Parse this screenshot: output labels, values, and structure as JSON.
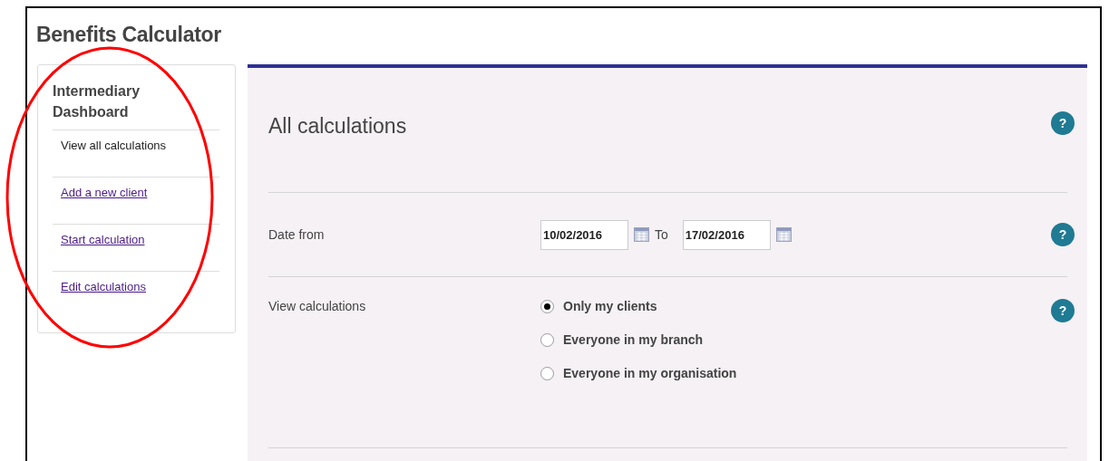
{
  "window": {
    "title": "Benefits Calculator"
  },
  "sidebar": {
    "heading": "Intermediary Dashboard",
    "items": [
      {
        "label": "View all calculations",
        "selected": true
      },
      {
        "label": "Add a new client",
        "selected": false
      },
      {
        "label": "Start calculation",
        "selected": false
      },
      {
        "label": "Edit calculations",
        "selected": false
      }
    ]
  },
  "panel": {
    "heading": "All calculations",
    "help": "?",
    "rows": [
      {
        "kind": "date_range",
        "label": "Date from",
        "date_from": "10/02/2016",
        "separator": "To",
        "date_to": "17/02/2016",
        "help": "?"
      },
      {
        "kind": "radio_group",
        "label": "View calculations",
        "help": "?",
        "options": [
          {
            "label": "Only my clients",
            "selected": true
          },
          {
            "label": "Everyone in my branch",
            "selected": false
          },
          {
            "label": "Everyone in my organisation",
            "selected": false
          }
        ]
      }
    ]
  },
  "annotations": [
    {
      "kind": "ellipse",
      "color": "#ff0000"
    }
  ]
}
